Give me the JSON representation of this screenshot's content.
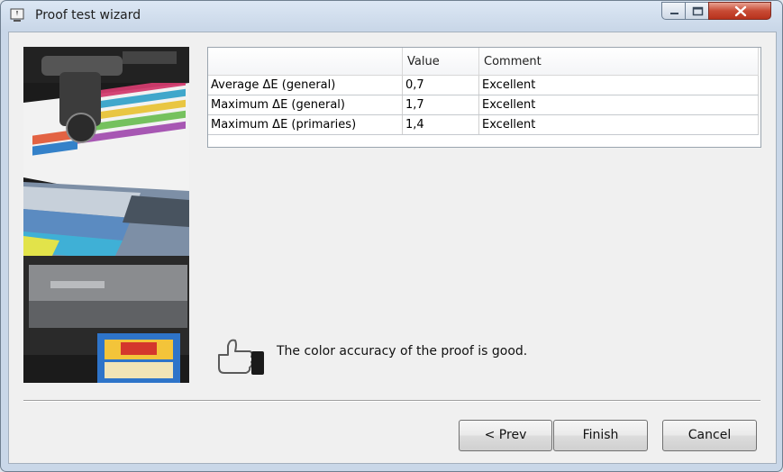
{
  "window": {
    "title": "Proof test wizard",
    "icon": "monitor-icon",
    "controls": [
      "minimize-icon",
      "maximize-icon",
      "close-icon"
    ]
  },
  "image_panel": {
    "description_icon": "print-proof-image"
  },
  "table": {
    "headers": [
      "",
      "Value",
      "Comment"
    ],
    "rows": [
      {
        "metric": "Average ΔE (general)",
        "value": "0,7",
        "comment": "Excellent"
      },
      {
        "metric": "Maximum ΔE (general)",
        "value": "1,7",
        "comment": "Excellent"
      },
      {
        "metric": "Maximum ΔE (primaries)",
        "value": "1,4",
        "comment": "Excellent"
      }
    ]
  },
  "result": {
    "icon": "thumbs-up-icon",
    "message": "The color accuracy of the proof is good."
  },
  "buttons": {
    "prev": "< Prev",
    "finish": "Finish",
    "cancel": "Cancel"
  }
}
